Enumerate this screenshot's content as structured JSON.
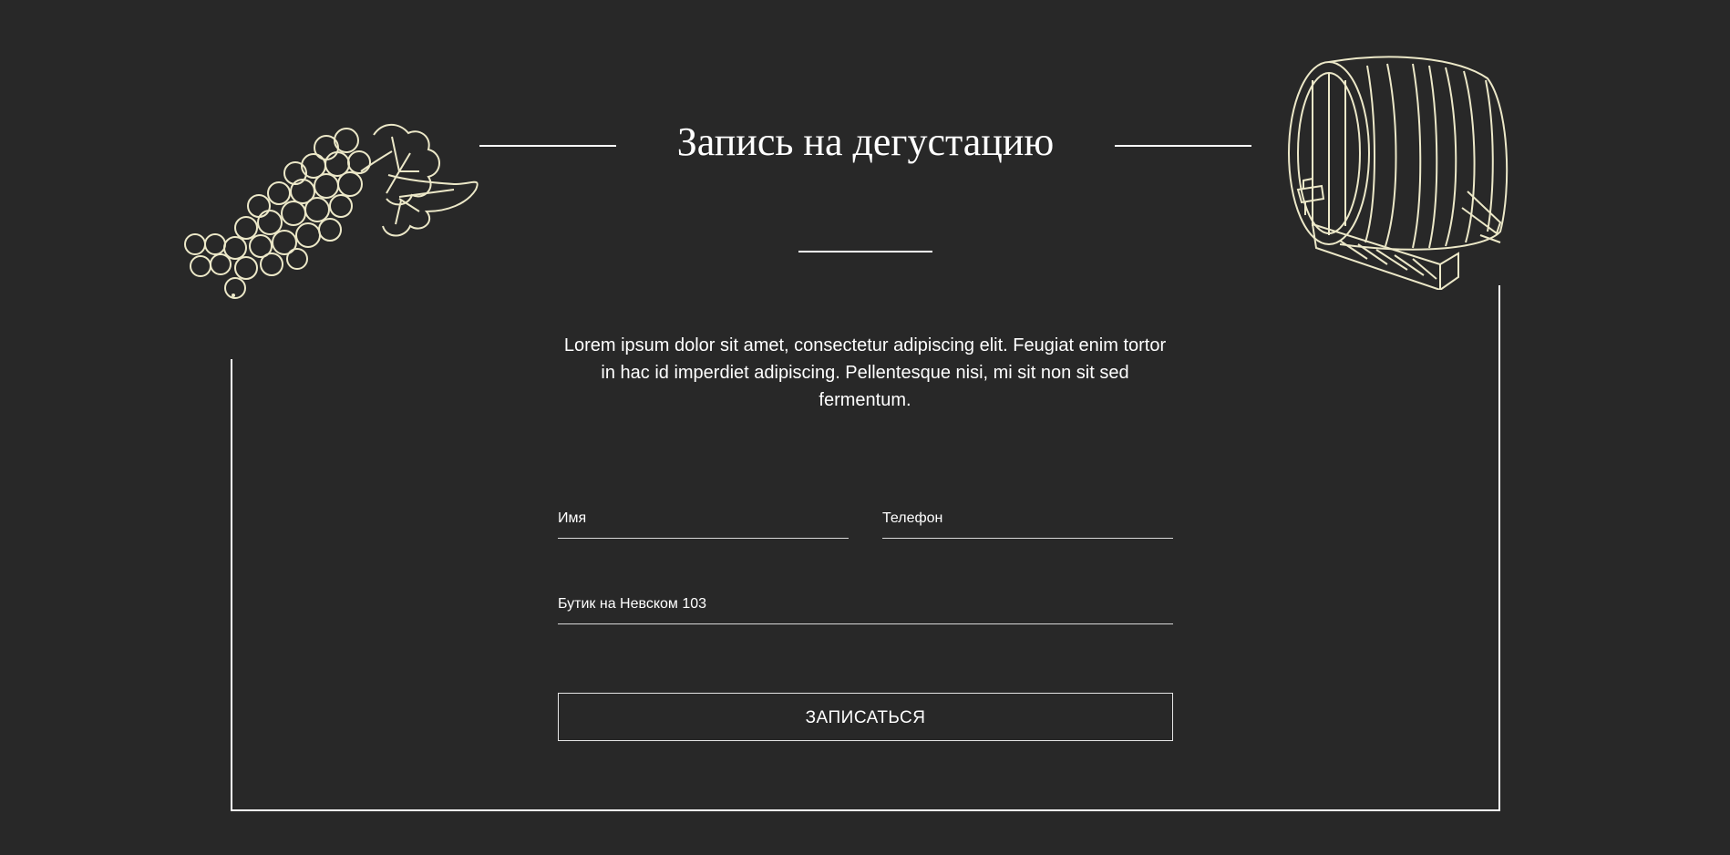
{
  "header": {
    "title": "Запись на дегустацию"
  },
  "intro": {
    "text": "Lorem ipsum dolor sit amet, consectetur adipiscing elit. Feugiat enim tortor in hac id imperdiet adipiscing. Pellentesque nisi, mi sit non sit sed fermentum."
  },
  "form": {
    "name_placeholder": "Имя",
    "phone_placeholder": "Телефон",
    "store_value": "Бутик на Невском 103",
    "submit_label": "ЗАПИСАТЬСЯ"
  },
  "illustrations": {
    "left": "grapes-icon",
    "right": "barrel-icon"
  },
  "colors": {
    "background": "#282828",
    "text": "#ffffff",
    "illustration": "#ece8c8"
  }
}
